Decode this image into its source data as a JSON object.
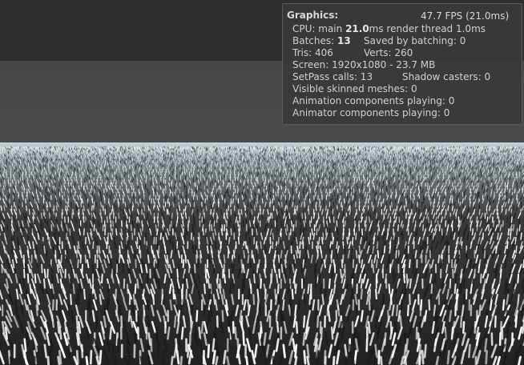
{
  "stats": {
    "title": "Graphics:",
    "fps": "47.7 FPS (21.0ms)",
    "cpu_prefix": "CPU: main ",
    "cpu_main": "21.0",
    "cpu_suffix": "ms  render thread 1.0ms",
    "batches_label": "Batches: ",
    "batches_value": "13",
    "saved_by_batching": "Saved by batching: 0",
    "tris": "Tris: 406",
    "verts": "Verts: 260",
    "screen": "Screen: 1920x1080 - 23.7 MB",
    "setpass": "SetPass calls: 13",
    "shadow_casters": "Shadow casters: 0",
    "skinned_meshes": "Visible skinned meshes: 0",
    "animation_components": "Animation components playing: 0",
    "animator_components": "Animator components playing: 0"
  },
  "colors": {
    "top_bar": "#2e2e2e",
    "sky": "#464646",
    "panel_bg": "#3a3a3a",
    "grass_highlight": "#ffffff",
    "grass_shadow": "#1a1a1a"
  }
}
